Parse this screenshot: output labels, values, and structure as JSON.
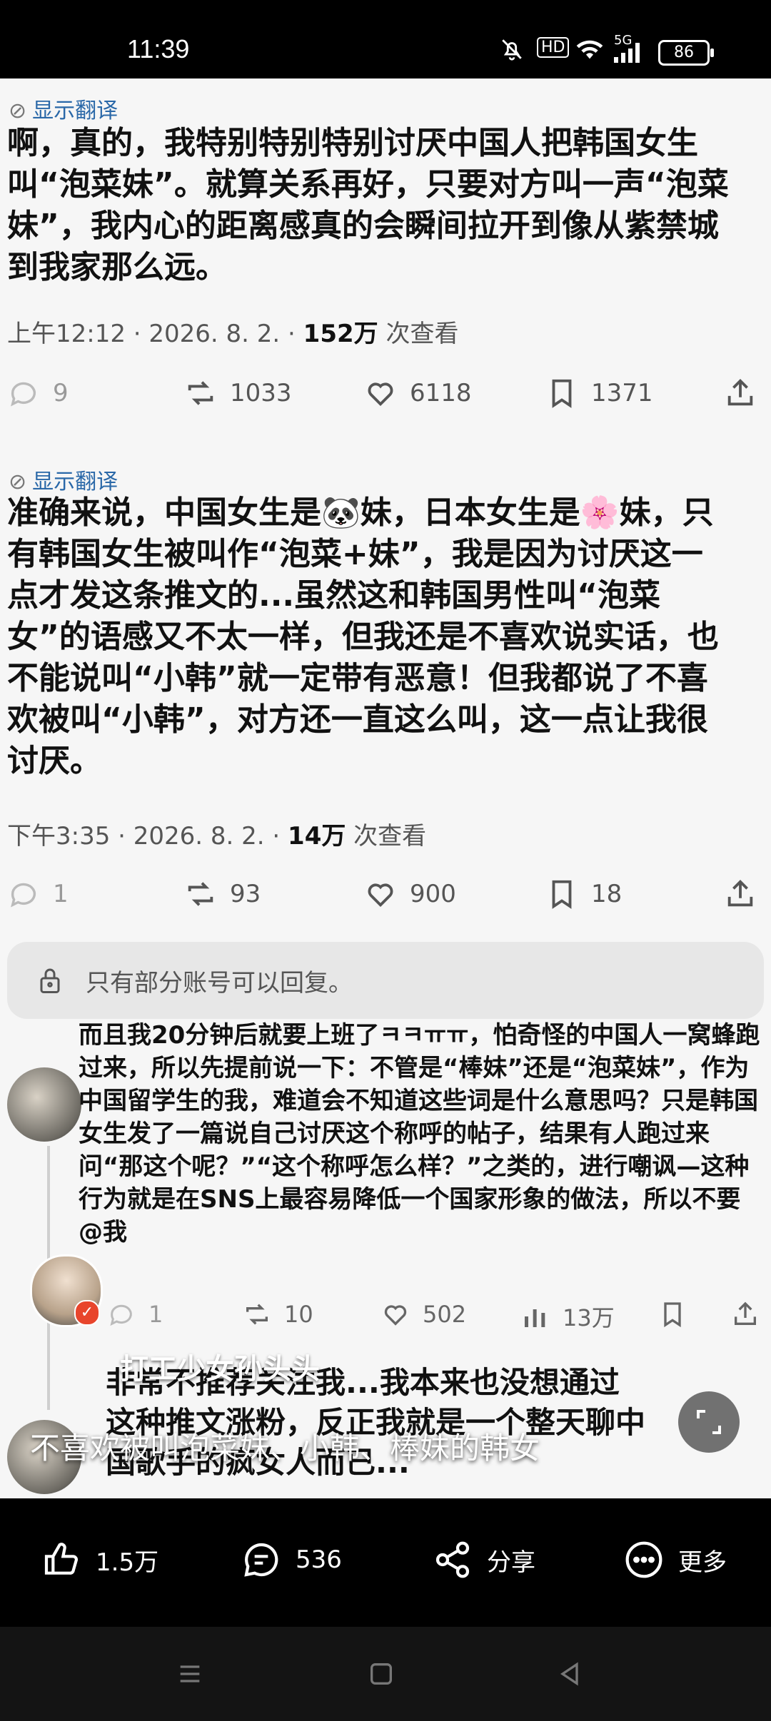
{
  "status_bar": {
    "time": "11:39",
    "network": "5G",
    "hd": "HD",
    "battery": "86"
  },
  "tweet1": {
    "translate_label": "显示翻译",
    "text": "啊，真的，我特别特别特别讨厌中国人把韩国女生叫“泡菜妹”。就算关系再好，只要对方叫一声“泡菜妹”，我内心的距离感真的会瞬间拉开到像从紫禁城到我家那么远。",
    "meta_prefix": "上午12:12 · 2026. 8. 2. · ",
    "views": "152万",
    "views_suffix": " 次查看",
    "replies": "9",
    "retweets": "1033",
    "likes": "6118",
    "bookmarks": "1371"
  },
  "tweet2": {
    "translate_label": "显示翻译",
    "text": "准确来说，中国女生是🐼妹，日本女生是🌸妹，只有韩国女生被叫作“泡菜+妹”，我是因为讨厌这一点才发这条推文的...虽然这和韩国男性叫“泡菜女”的语感又不太一样，但我还是不喜欢说实话，也不能说叫“小韩”就一定带有恶意！但我都说了不喜欢被叫“小韩”，对方还一直这么叫，这一点让我很讨厌。",
    "meta_prefix": "下午3:35 · 2026. 8. 2. · ",
    "views": "14万",
    "views_suffix": " 次查看",
    "replies": "1",
    "retweets": "93",
    "likes": "900",
    "bookmarks": "18"
  },
  "reply_restriction": "只有部分账号可以回复。",
  "reply1": {
    "text": "而且我20分钟后就要上班了ㅋㅋㅠㅠ，怕奇怪的中国人一窝蜂跑过来，所以先提前说一下：不管是“棒妹”还是“泡菜妹”，作为中国留学生的我，难道会不知道这些词是什么意思吗？只是韩国女生发了一篇说自己讨厌这个称呼的帖子，结果有人跑过来问“那这个呢？”“这个称呼怎么样？”之类的，进行嘲讽—这种行为就是在SNS上最容易降低一个国家形象的做法，所以不要@我",
    "replies": "1",
    "retweets": "10",
    "likes": "502",
    "views": "13万"
  },
  "reply2": {
    "text": "非常不推荐关注我...我本来也没想通过这种推文涨粉，反正我就是一个整天聊中国歌手的疯女人而已..."
  },
  "video": {
    "author": "打工少女孙头头",
    "caption": "不喜欢被叫泡菜妹、小韩、棒妹的韩女"
  },
  "bottom_bar": {
    "likes": "1.5万",
    "comments": "536",
    "share": "分享",
    "more": "更多"
  }
}
